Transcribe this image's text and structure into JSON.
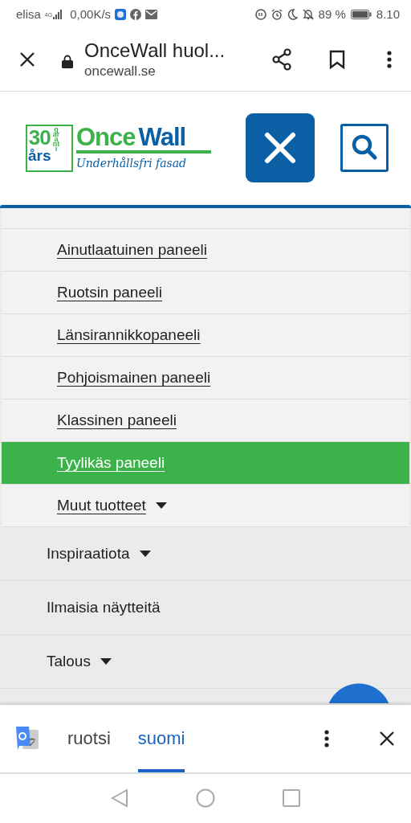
{
  "status_bar": {
    "carrier": "elisa",
    "network": "4G",
    "speed": "0,00K/s",
    "battery": "89 %",
    "time": "8.10"
  },
  "browser": {
    "title": "OnceWall huol...",
    "url": "oncewall.se"
  },
  "logo": {
    "years": "30",
    "unit": "års",
    "guarantee": "garanti",
    "brand_first": "Once",
    "brand_second": "Wall",
    "tagline": "Underhållsfri fasad"
  },
  "submenu": [
    {
      "label": "Ainutlaatuinen paneeli",
      "selected": false,
      "dropdown": false
    },
    {
      "label": "Ruotsin paneeli",
      "selected": false,
      "dropdown": false
    },
    {
      "label": "Länsirannikkopaneeli",
      "selected": false,
      "dropdown": false
    },
    {
      "label": "Pohjoismainen paneeli",
      "selected": false,
      "dropdown": false
    },
    {
      "label": "Klassinen paneeli",
      "selected": false,
      "dropdown": false
    },
    {
      "label": "Tyylikäs paneeli",
      "selected": true,
      "dropdown": false
    },
    {
      "label": "Muut tuotteet",
      "selected": false,
      "dropdown": true
    }
  ],
  "menu": [
    {
      "label": "Inspiraatiota",
      "dropdown": true
    },
    {
      "label": "Ilmaisia näytteitä",
      "dropdown": false
    },
    {
      "label": "Talous",
      "dropdown": true
    }
  ],
  "translate_bar": {
    "languages": [
      {
        "label": "ruotsi",
        "selected": false
      },
      {
        "label": "suomi",
        "selected": true
      }
    ]
  }
}
